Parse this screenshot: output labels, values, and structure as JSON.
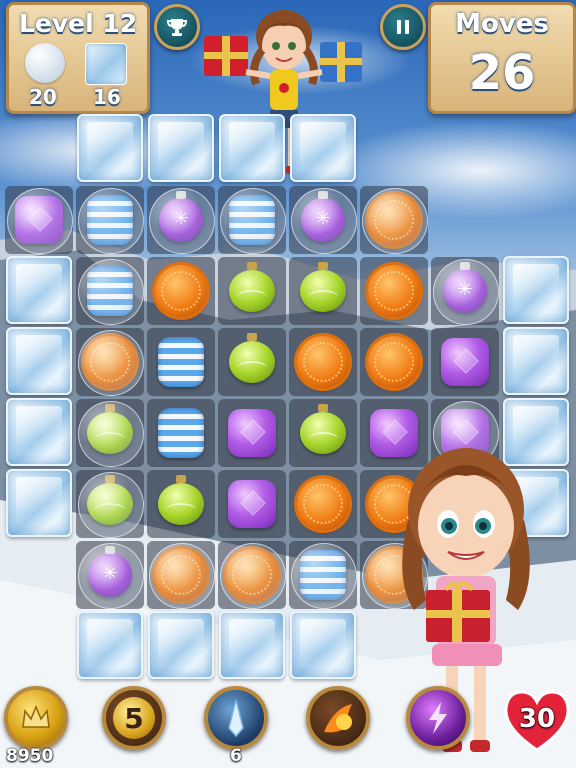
{
  "hud": {
    "level_label": "Level 12",
    "goals": [
      {
        "icon": "bubble-icon",
        "count": "20"
      },
      {
        "icon": "ice-block-icon",
        "count": "16"
      }
    ],
    "moves_label": "Moves",
    "moves_value": "26",
    "trophy_icon": "trophy-icon",
    "pause_icon": "pause-icon"
  },
  "board": {
    "columns": 8,
    "rows": 8,
    "cells": [
      [
        "",
        "ice",
        "ice",
        "ice",
        "ice",
        "",
        "",
        ""
      ],
      [
        "bubble:purple",
        "bubble:blue",
        "bubble:ornament",
        "bubble:blue",
        "bubble:ornament",
        "bubble:orange",
        "",
        ""
      ],
      [
        "ice",
        "bubble:blue",
        "orange",
        "green",
        "green",
        "orange",
        "bubble:ornament",
        "ice"
      ],
      [
        "ice",
        "bubble:orange",
        "blue",
        "green",
        "orange",
        "orange",
        "purple",
        "ice"
      ],
      [
        "ice",
        "bubble:green",
        "blue",
        "purple",
        "green",
        "purple",
        "bubble:purple",
        "ice"
      ],
      [
        "ice",
        "bubble:green",
        "green",
        "purple",
        "orange",
        "orange",
        "",
        "ice"
      ],
      [
        "",
        "bubble:ornament",
        "bubble:orange",
        "bubble:orange",
        "bubble:blue",
        "bubble:orange",
        "",
        ""
      ],
      [
        "",
        "ice",
        "ice",
        "ice",
        "ice",
        "",
        "",
        ""
      ]
    ]
  },
  "footer": {
    "coins": "8950",
    "boosters": [
      {
        "name": "coin-icon",
        "count": ""
      },
      {
        "name": "five-moves-icon",
        "label": "5",
        "count": ""
      },
      {
        "name": "ice-spike-icon",
        "count": "6"
      },
      {
        "name": "fireball-icon",
        "count": ""
      },
      {
        "name": "lightning-orb-icon",
        "count": ""
      }
    ],
    "lives": "30"
  },
  "colors": {
    "panel": "#e6c58d",
    "accent_text_outline": "#2c4f7a",
    "heart": "#e3233a"
  }
}
